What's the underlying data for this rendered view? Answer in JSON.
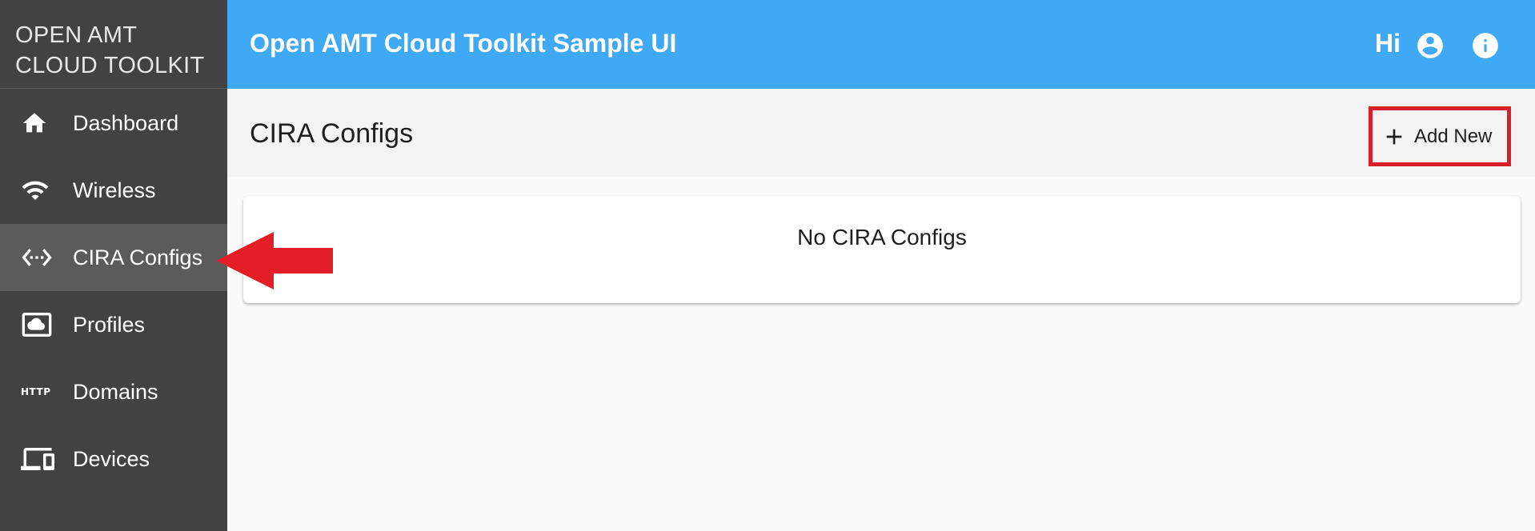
{
  "sidebar": {
    "brand_line1": "OPEN AMT",
    "brand_line2": "CLOUD TOOLKIT",
    "items": [
      {
        "label": "Dashboard",
        "icon": "home-icon"
      },
      {
        "label": "Wireless",
        "icon": "wifi-icon"
      },
      {
        "label": "CIRA Configs",
        "icon": "settings-ethernet-icon",
        "active": true
      },
      {
        "label": "Profiles",
        "icon": "cloud-profile-icon"
      },
      {
        "label": "Domains",
        "icon": "http-icon",
        "icon_text": "HTTP"
      },
      {
        "label": "Devices",
        "icon": "devices-icon"
      }
    ]
  },
  "header": {
    "title": "Open AMT Cloud Toolkit Sample UI",
    "greeting": "Hi"
  },
  "subheader": {
    "title": "CIRA Configs",
    "add_label": "Add New"
  },
  "content": {
    "empty_message": "No CIRA Configs"
  },
  "colors": {
    "header_bg": "#3fa9f5",
    "sidebar_bg": "#424242",
    "sidebar_active_bg": "#5b5b5b",
    "annotation_red": "#e31e26"
  }
}
